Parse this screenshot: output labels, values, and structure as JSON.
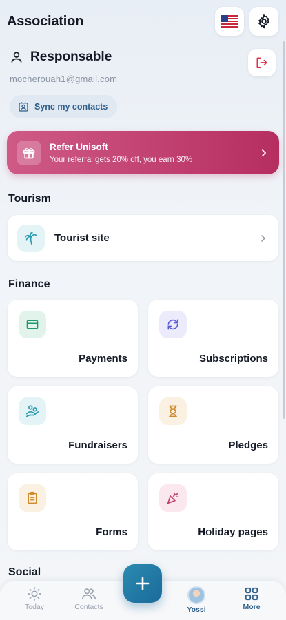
{
  "header": {
    "title": "Association",
    "language_icon": "us-flag-icon",
    "settings_icon": "gear-icon"
  },
  "user": {
    "name": "Responsable",
    "email": "mocherouah1@gmail.com",
    "logout_icon": "logout-icon"
  },
  "sync": {
    "label": "Sync my contacts"
  },
  "refer": {
    "title": "Refer Unisoft",
    "subtitle": "Your referral gets 20% off, you earn 30%"
  },
  "sections": {
    "tourism": "Tourism",
    "finance": "Finance",
    "social": "Social"
  },
  "tourism_items": [
    {
      "label": "Tourist site",
      "icon": "palm-tree-icon"
    }
  ],
  "finance_items": [
    {
      "label": "Payments",
      "icon": "card-icon",
      "color": "#1e9a6e"
    },
    {
      "label": "Subscriptions",
      "icon": "refresh-icon",
      "color": "#5b5bd6"
    },
    {
      "label": "Fundraisers",
      "icon": "hand-coins-icon",
      "color": "#2a9ab0"
    },
    {
      "label": "Pledges",
      "icon": "hourglass-icon",
      "color": "#d08a2a"
    },
    {
      "label": "Forms",
      "icon": "clipboard-icon",
      "color": "#d08a2a"
    },
    {
      "label": "Holiday pages",
      "icon": "party-popper-icon",
      "color": "#c0406e"
    }
  ],
  "nav": [
    {
      "label": "Today",
      "icon": "sun-icon"
    },
    {
      "label": "Contacts",
      "icon": "users-icon"
    },
    {
      "label": "Yossi",
      "icon": "avatar"
    },
    {
      "label": "More",
      "icon": "grid-icon"
    }
  ],
  "fab": {
    "icon": "plus-icon"
  },
  "colors": {
    "accent": "#2f5f8a",
    "refer_start": "#cf5a86",
    "refer_end": "#b62e60",
    "fab": "#1b6a9a"
  }
}
